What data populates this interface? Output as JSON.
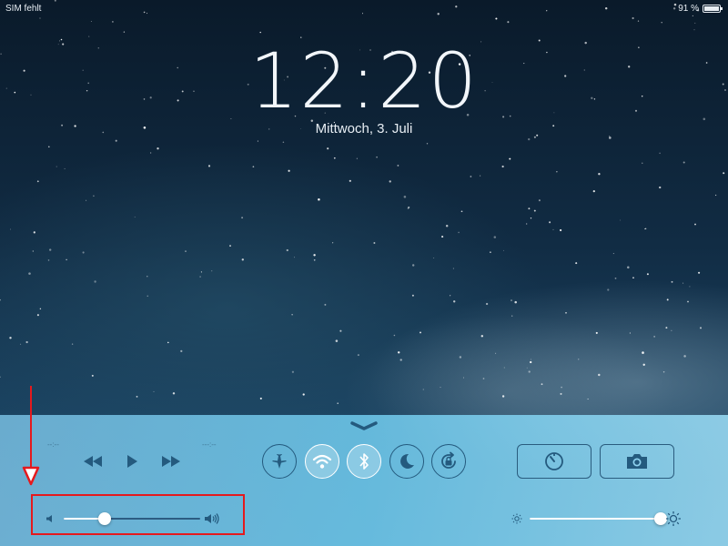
{
  "statusbar": {
    "carrier": "SIM fehlt",
    "battery_text": "91 %",
    "battery_level": 0.91
  },
  "lockscreen": {
    "time": "12:20",
    "date": "Mittwoch, 3. Juli"
  },
  "control_center": {
    "media": {
      "elapsed": "--:--",
      "remaining": "-‑-:--",
      "buttons": [
        "rewind-icon",
        "play-icon",
        "fast-forward-icon"
      ]
    },
    "toggles": [
      {
        "name": "airplane",
        "icon": "airplane-icon",
        "on": false
      },
      {
        "name": "wifi",
        "icon": "wifi-icon",
        "on": true
      },
      {
        "name": "bluetooth",
        "icon": "bluetooth-icon",
        "on": true
      },
      {
        "name": "do-not-disturb",
        "icon": "moon-icon",
        "on": false
      },
      {
        "name": "rotation-lock",
        "icon": "rotation-lock-icon",
        "on": false
      }
    ],
    "quick_actions": [
      {
        "name": "timer",
        "icon": "timer-icon"
      },
      {
        "name": "camera",
        "icon": "camera-icon"
      }
    ],
    "volume_level": 0.3,
    "brightness_level": 0.99
  },
  "colors": {
    "annotation": "#e5191d",
    "panel": "#6ec8eb",
    "icon": "#245a7e"
  }
}
